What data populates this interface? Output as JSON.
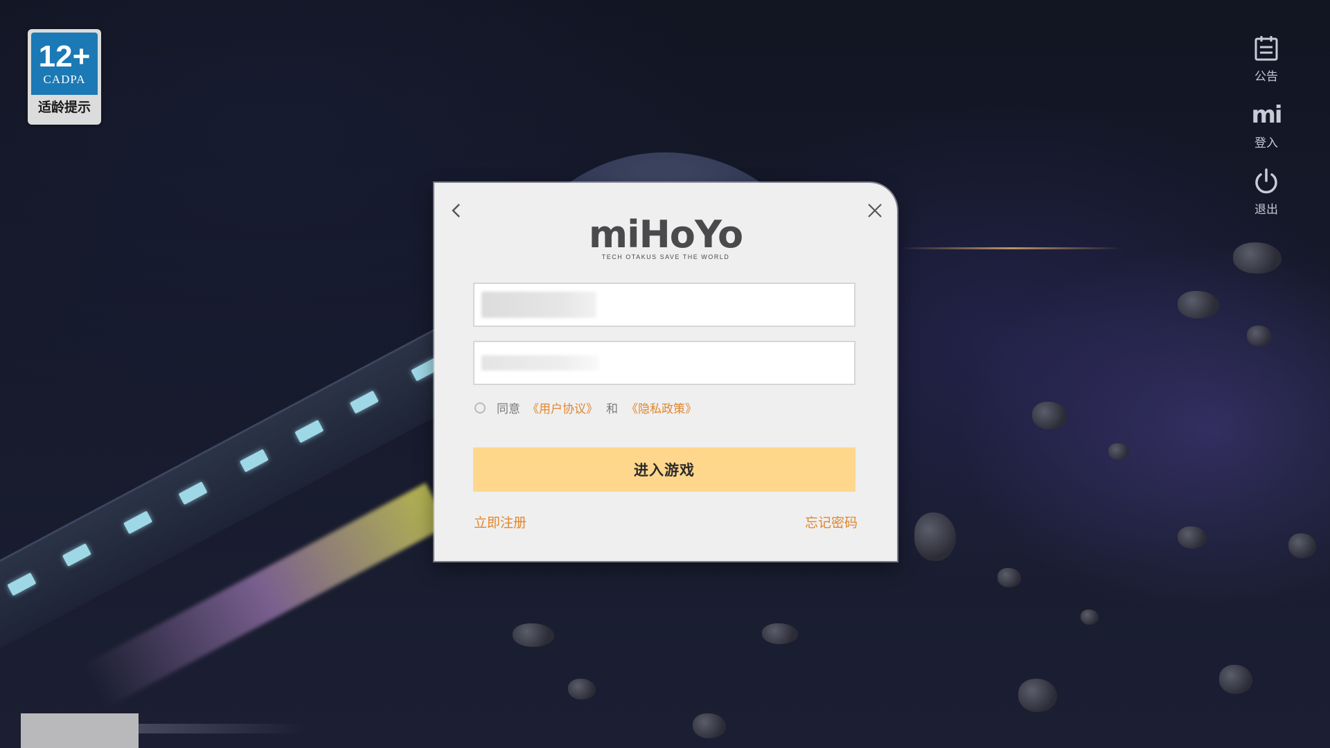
{
  "age_badge": {
    "number": "12+",
    "org": "CADPA",
    "label": "适龄提示"
  },
  "side_menu": {
    "items": [
      {
        "label": "公告",
        "icon": "notice-board-icon"
      },
      {
        "label": "登入",
        "icon": "mi-logo-icon",
        "glyph": "mi"
      },
      {
        "label": "退出",
        "icon": "power-icon"
      }
    ]
  },
  "dialog": {
    "logo_text": "miHoYo",
    "logo_tagline": "TECH OTAKUS SAVE THE WORLD",
    "agree_text": "同意",
    "user_agreement": "《用户协议》",
    "and_text": "和",
    "privacy_policy": "《隐私政策》",
    "enter_button": "进入游戏",
    "register_link": "立即注册",
    "forgot_link": "忘记密码"
  },
  "colors": {
    "accent_orange": "#e2862a",
    "button_yellow": "#fed78d",
    "badge_blue": "#1b79b5",
    "dialog_bg": "#efeff0"
  }
}
